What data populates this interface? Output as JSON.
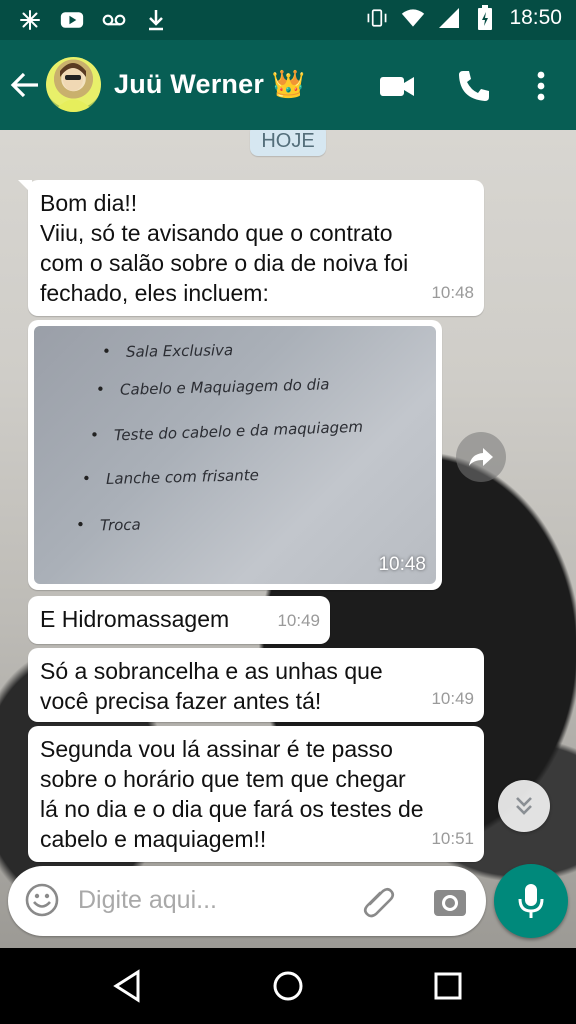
{
  "status_bar": {
    "time": "18:50"
  },
  "header": {
    "contact_name": "Juü Werner",
    "crown": "👑"
  },
  "chat": {
    "day_chip": "HOJE",
    "messages": [
      {
        "text": "Bom dia!!\nViiu, só te avisando que o contrato\ncom o salão sobre o dia de noiva foi\nfechado, eles incluem:",
        "time": "10:48"
      },
      {
        "image_lines": [
          "Sala Exclusiva",
          "Cabelo e Maquiagem do dia",
          "Teste do cabelo e da maquiagem",
          "Lanche com frisante",
          "Troca"
        ],
        "time": "10:48"
      },
      {
        "text": "E Hidromassagem",
        "time": "10:49"
      },
      {
        "text": "Só a sobrancelha e as unhas que\nvocê precisa fazer antes tá!",
        "time": "10:49"
      },
      {
        "text": "Segunda vou lá assinar é te passo\nsobre o horário que tem que chegar\nlá no dia e o dia que fará os testes de\ncabelo e maquiagem!!",
        "time": "10:51"
      }
    ]
  },
  "composer": {
    "placeholder": "Digite aqui..."
  },
  "icons": {
    "status": [
      "sparkle-icon",
      "youtube-icon",
      "voicemail-icon",
      "download-icon",
      "vibrate-icon",
      "wifi-icon",
      "signal-icon",
      "battery-icon"
    ],
    "header": [
      "back-arrow-icon",
      "video-call-icon",
      "phone-icon",
      "more-vert-icon"
    ],
    "composer": [
      "emoji-icon",
      "attach-icon",
      "camera-icon",
      "mic-icon"
    ],
    "nav": [
      "nav-back-icon",
      "nav-home-icon",
      "nav-recents-icon"
    ]
  },
  "colors": {
    "header": "#075e54",
    "status_bar": "#054d44",
    "accent": "#00897b",
    "bubble": "#ffffff"
  }
}
